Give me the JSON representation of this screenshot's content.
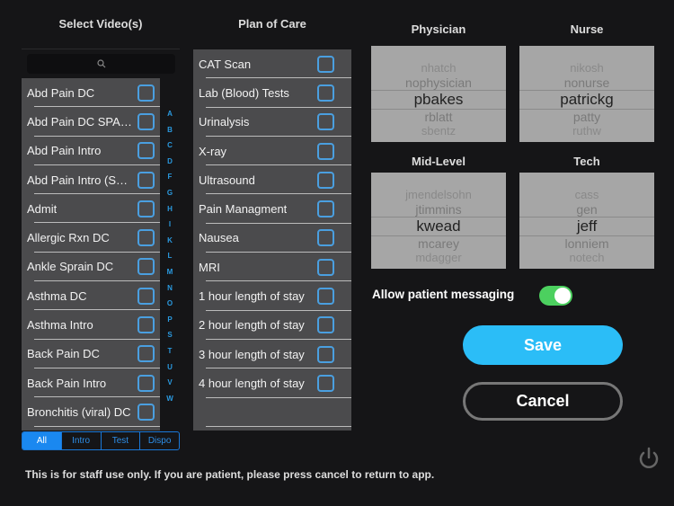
{
  "videos": {
    "title": "Select Video(s)",
    "items": [
      "Abd Pain DC",
      "Abd Pain DC SPANISH",
      "Abd Pain Intro",
      "Abd Pain Intro (SPANISH)",
      "Admit",
      "Allergic Rxn DC",
      "Ankle Sprain DC",
      "Asthma DC",
      "Asthma Intro",
      "Back Pain DC",
      "Back Pain Intro",
      "Bronchitis (viral) DC"
    ],
    "index": [
      "A",
      "B",
      "C",
      "D",
      "F",
      "G",
      "H",
      "I",
      "K",
      "L",
      "M",
      "N",
      "O",
      "P",
      "S",
      "T",
      "U",
      "V",
      "W"
    ],
    "filters": [
      "All",
      "Intro",
      "Test",
      "Dispo"
    ],
    "selected_filter": "All"
  },
  "plan": {
    "title": "Plan of Care",
    "items": [
      "CAT Scan",
      "Lab (Blood) Tests",
      "Urinalysis",
      "X-ray",
      "Ultrasound",
      "Pain Managment",
      "Nausea",
      "MRI",
      "1 hour length of stay",
      "2 hour length of stay",
      "3 hour length of stay",
      "4 hour length of stay"
    ]
  },
  "pickers": {
    "physician": {
      "label": "Physician",
      "items": [
        "nhatch",
        "nophysician",
        "pbakes",
        "rblatt",
        "sbentz"
      ],
      "selected": "pbakes"
    },
    "nurse": {
      "label": "Nurse",
      "items": [
        "nikosh",
        "nonurse",
        "patrickg",
        "patty",
        "ruthw"
      ],
      "selected": "patrickg"
    },
    "midlevel": {
      "label": "Mid-Level",
      "items": [
        "jmendelsohn",
        "jtimmins",
        "kwead",
        "mcarey",
        "mdagger"
      ],
      "selected": "kwead"
    },
    "tech": {
      "label": "Tech",
      "items": [
        "cass",
        "gen",
        "jeff",
        "lonniem",
        "notech"
      ],
      "selected": "jeff"
    }
  },
  "messaging": {
    "label": "Allow patient messaging",
    "enabled": true
  },
  "save_label": "Save",
  "cancel_label": "Cancel",
  "footer": "This is for staff use only. If you are patient, please press cancel to return to app.",
  "colors": {
    "accent": "#2bbdf7",
    "toggle_on": "#4cd05f",
    "checkbox": "#4a9fe0"
  }
}
